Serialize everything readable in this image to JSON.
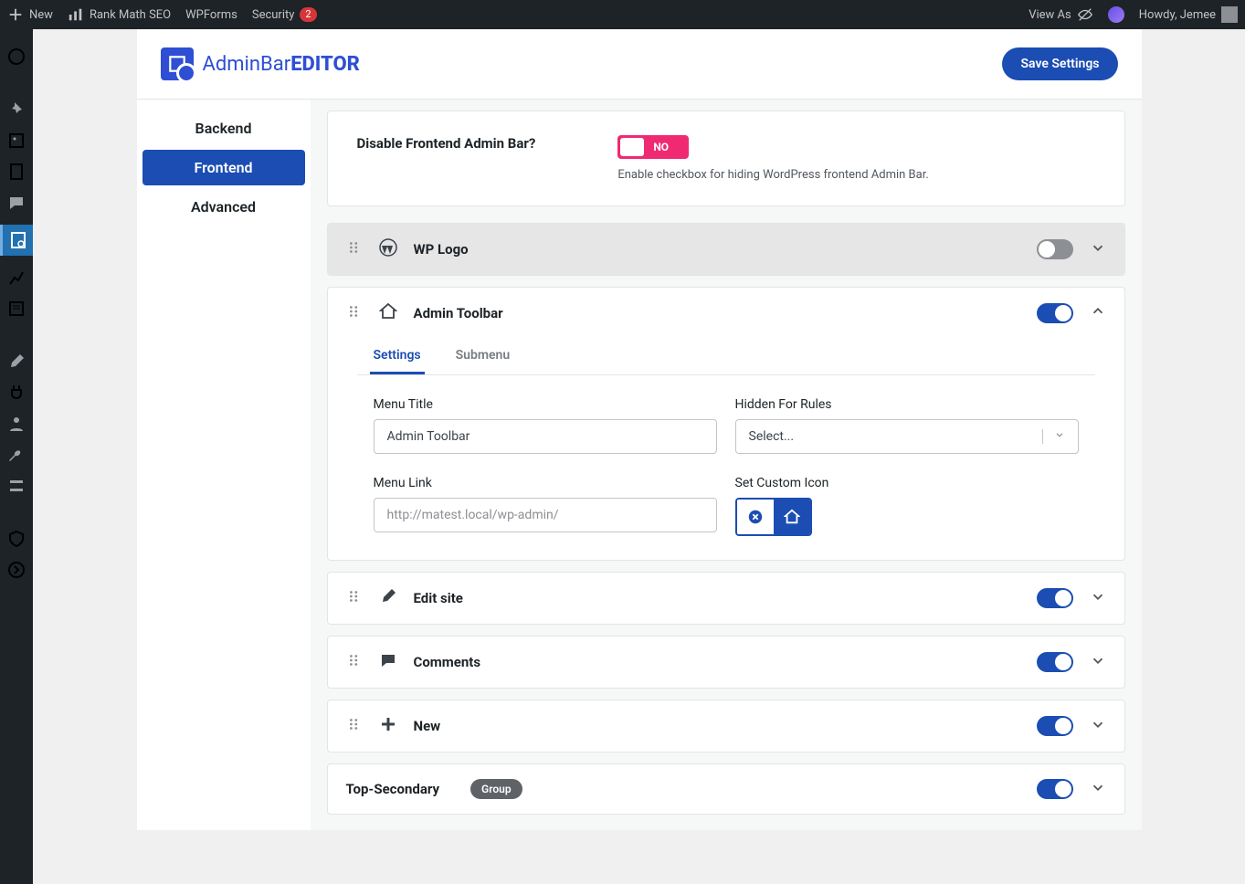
{
  "adminbar": {
    "new": "New",
    "rankmath": "Rank Math SEO",
    "wpforms": "WPForms",
    "security": "Security",
    "security_badge": "2",
    "viewas": "View As",
    "greeting": "Howdy, Jemee"
  },
  "plugin": {
    "title_light": "AdminBar",
    "title_bold": "EDITOR",
    "save": "Save Settings"
  },
  "subnav": {
    "backend": "Backend",
    "frontend": "Frontend",
    "advanced": "Advanced"
  },
  "disable_card": {
    "question": "Disable Frontend Admin Bar?",
    "toggle": "NO",
    "desc": "Enable checkbox for hiding WordPress frontend Admin Bar."
  },
  "items": {
    "wp_logo": "WP Logo",
    "admin_toolbar": "Admin Toolbar",
    "edit_site": "Edit site",
    "comments": "Comments",
    "new": "New",
    "top_secondary": "Top-Secondary",
    "group": "Group"
  },
  "inner_tabs": {
    "settings": "Settings",
    "submenu": "Submenu"
  },
  "form": {
    "menu_title_label": "Menu Title",
    "menu_title_value": "Admin Toolbar",
    "hidden_rules_label": "Hidden For Rules",
    "hidden_rules_placeholder": "Select...",
    "menu_link_label": "Menu Link",
    "menu_link_value": "http://matest.local/wp-admin/",
    "custom_icon_label": "Set Custom Icon"
  }
}
